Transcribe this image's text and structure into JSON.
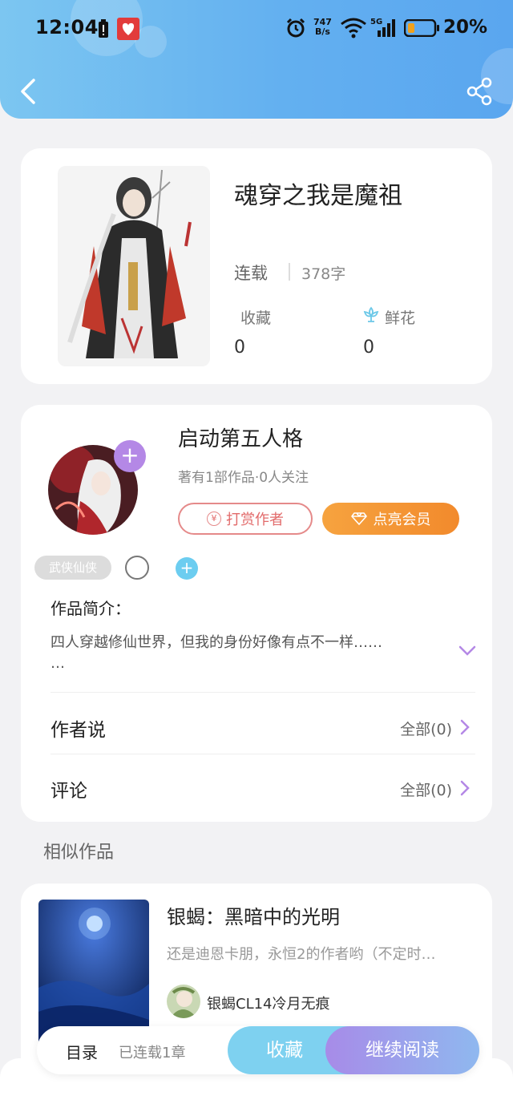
{
  "status_bar": {
    "time": "12:04",
    "net_speed_top": "747",
    "net_speed_unit": "B/s",
    "network": "5G",
    "battery": "20%"
  },
  "header": {
    "back_icon": "chevron-left-icon",
    "share_icon": "share-icon",
    "gradient_start": "#7cc6f1",
    "gradient_end": "#5aa6ef"
  },
  "book": {
    "title": "魂穿之我是魔祖",
    "status": "连载",
    "word_count": "378字",
    "favorites_label": "收藏",
    "favorites_value": "0",
    "flowers_label": "鲜花",
    "flowers_value": "0"
  },
  "author": {
    "name": "启动第五人格",
    "stats": "著有1部作品·0人关注",
    "follow_symbol": "+",
    "tip_label": "打赏作者",
    "tip_symbol": "¥",
    "vip_label": "点亮会员",
    "tag": "武侠仙侠",
    "add_tag_symbol": "+",
    "intro_label": "作品简介：",
    "intro_text": "四人穿越修仙世界，但我的身份好像有点不一样……",
    "intro_ellipsis": "…",
    "author_says_label": "作者说",
    "author_says_link": "全部(0)",
    "comments_label": "评论",
    "comments_link": "全部(0)"
  },
  "similar": {
    "section_title": "相似作品",
    "items": [
      {
        "title": "银蝎：黑暗中的光明",
        "desc": "还是迪恩卡朋，永恒2的作者哟（不定时…",
        "author": "银蝎CL14冷月无痕"
      }
    ]
  },
  "bottom_bar": {
    "toc_label": "目录",
    "chapters_label": "已连载1章",
    "collect_label": "收藏",
    "read_label": "继续阅读"
  },
  "colors": {
    "accent_purple": "#b488e6",
    "tip_red": "#e26b6b",
    "vip_orange": "#f28a2c",
    "light_blue": "#7ed1f0"
  }
}
